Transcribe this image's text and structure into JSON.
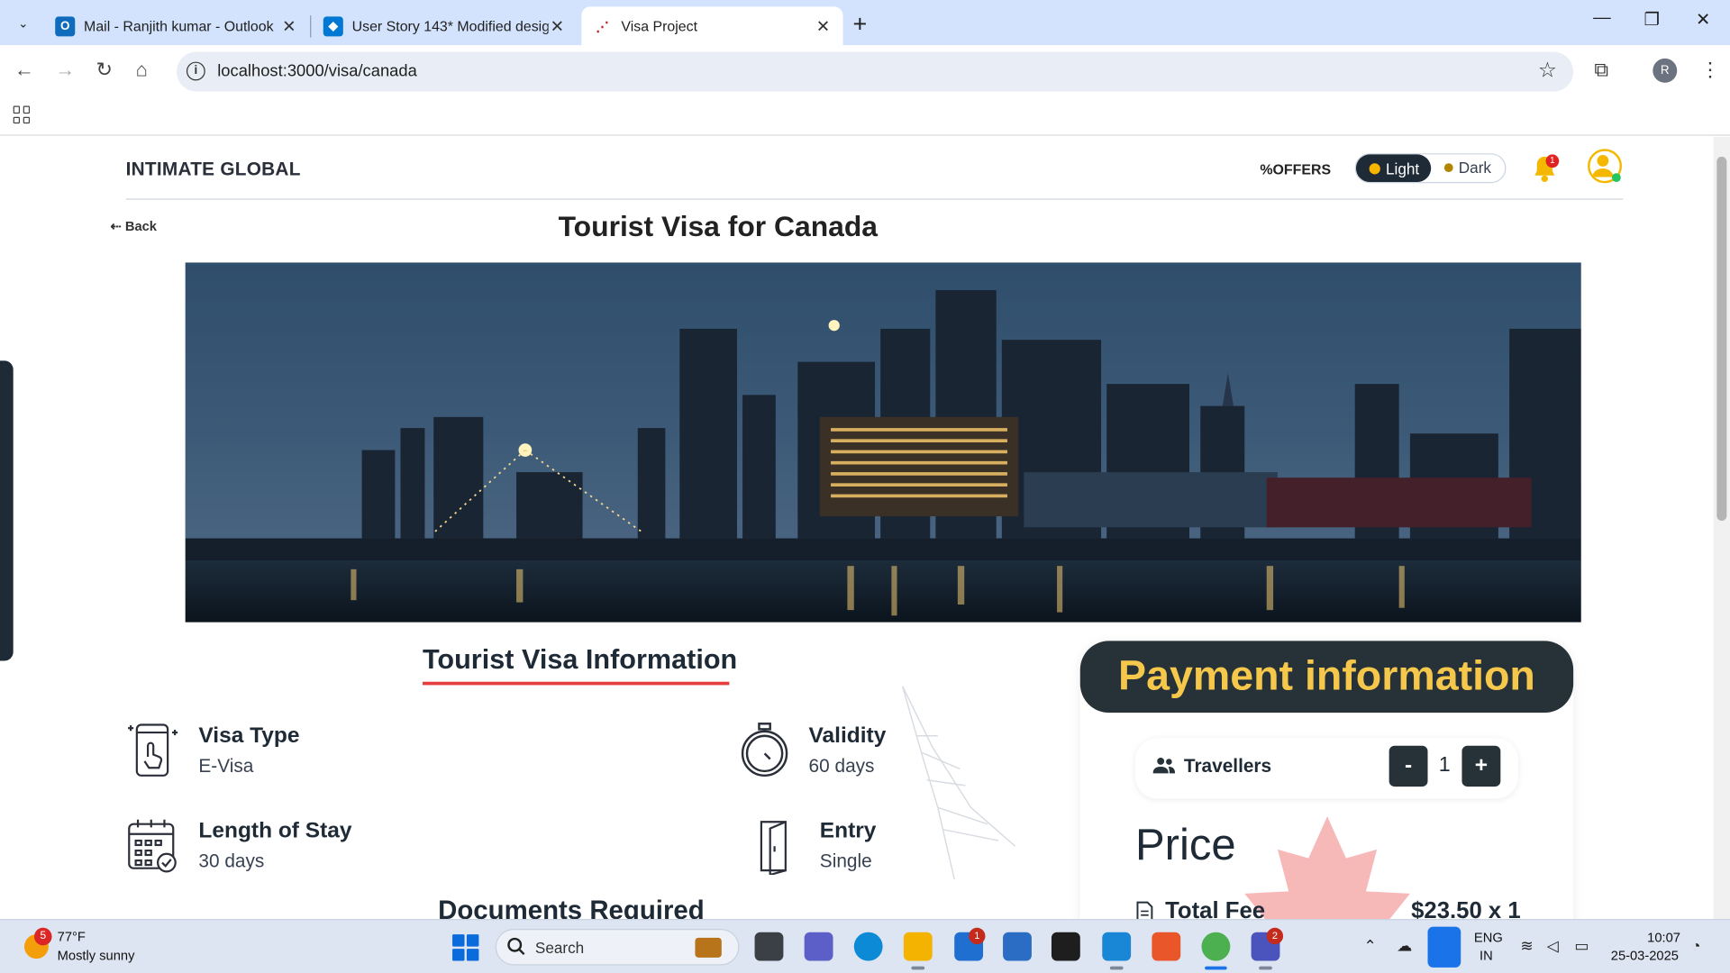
{
  "browser": {
    "tabs": [
      {
        "label": "Mail - Ranjith kumar - Outlook"
      },
      {
        "label": "User Story 143* Modified desig"
      },
      {
        "label": "Visa Project"
      }
    ],
    "new_tab_glyph": "+",
    "url": "localhost:3000/visa/canada",
    "profile_initial": "R"
  },
  "header": {
    "brand": "INTIMATE GLOBAL",
    "offers": "%OFFERS",
    "theme_light": "Light",
    "theme_dark": "Dark",
    "notification_count": "1"
  },
  "page": {
    "back_label": "Back",
    "title": "Tourist Visa for Canada",
    "section_title": "Tourist Visa Information",
    "documents_title": "Documents Required"
  },
  "visa_info": {
    "visa_type_label": "Visa Type",
    "visa_type_value": "E-Visa",
    "validity_label": "Validity",
    "validity_value": "60 days",
    "stay_label": "Length of Stay",
    "stay_value": "30 days",
    "entry_label": "Entry",
    "entry_value": "Single"
  },
  "payment": {
    "heading": "Payment information",
    "travellers_label": "Travellers",
    "minus": "-",
    "plus": "+",
    "travellers_count": "1",
    "price_label": "Price",
    "fee_label": "Total Fee",
    "fee_value": "$23.50 x 1"
  },
  "taskbar": {
    "weather_badge": "5",
    "temperature": "77°F",
    "weather": "Mostly sunny",
    "search": "Search",
    "store_badge": "1",
    "teams_badge": "2",
    "lang_line1": "ENG",
    "lang_line2": "IN",
    "time": "10:07",
    "date": "25-03-2025"
  },
  "colors": {
    "accent_dark": "#263238",
    "payment_heading_text": "#f5c84c",
    "underline_red": "#e53e3e",
    "tabstrip": "#d3e3fd"
  },
  "icons": [
    "search-tabs-icon",
    "outlook-icon",
    "azure-devops-icon",
    "visa-project-icon",
    "close-icon",
    "back-arrow-icon",
    "forward-arrow-icon",
    "reload-icon",
    "home-icon",
    "site-info-icon",
    "bookmark-star-icon",
    "extensions-icon",
    "menu-dots-icon",
    "apps-grid-icon",
    "bell-icon",
    "avatar-icon",
    "phone-touch-icon",
    "stopwatch-icon",
    "calendar-check-icon",
    "door-icon",
    "users-icon",
    "document-icon",
    "maple-leaf-icon",
    "eiffel-tower-icon",
    "windows-start-icon"
  ]
}
